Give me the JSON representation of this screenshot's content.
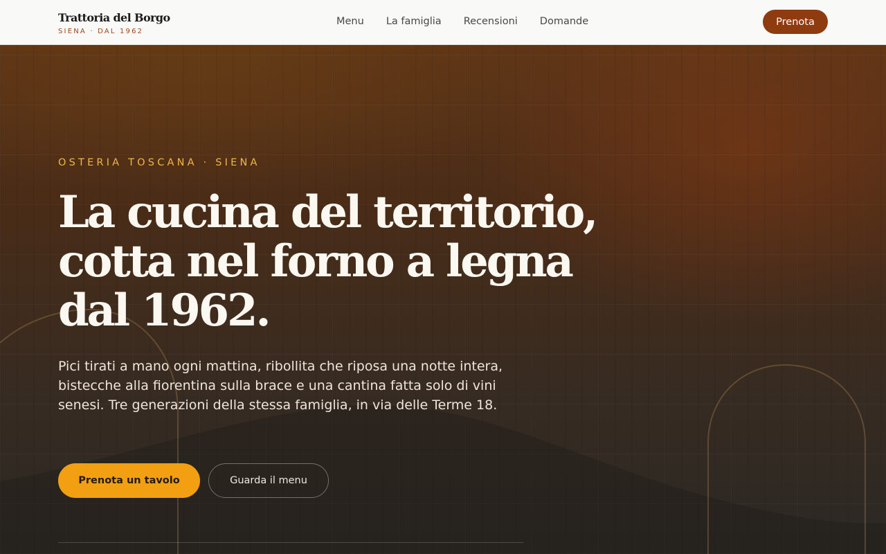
{
  "header": {
    "brand_name": "Trattoria del Borgo",
    "brand_tagline": "SIENA · DAL 1962",
    "nav": [
      {
        "label": "Menu"
      },
      {
        "label": "La famiglia"
      },
      {
        "label": "Recensioni"
      },
      {
        "label": "Domande"
      }
    ],
    "cta_label": "Prenota"
  },
  "hero": {
    "eyebrow": "OSTERIA TOSCANA · SIENA",
    "headline": "La cucina del territorio, cotta nel forno a legna dal 1962.",
    "lede": "Pici tirati a mano ogni mattina, ribollita che riposa una notte intera, bistecche alla fiorentina sulla brace e una cantina fatta solo di vini senesi. Tre generazioni della stessa famiglia, in via delle Terme 18.",
    "primary_cta": "Prenota un tavolo",
    "secondary_cta": "Guarda il menu"
  },
  "colors": {
    "accent": "#f2a011",
    "brand": "#8e3b10",
    "eyebrow": "#f0b64a",
    "header_bg": "#f9f9f7"
  }
}
